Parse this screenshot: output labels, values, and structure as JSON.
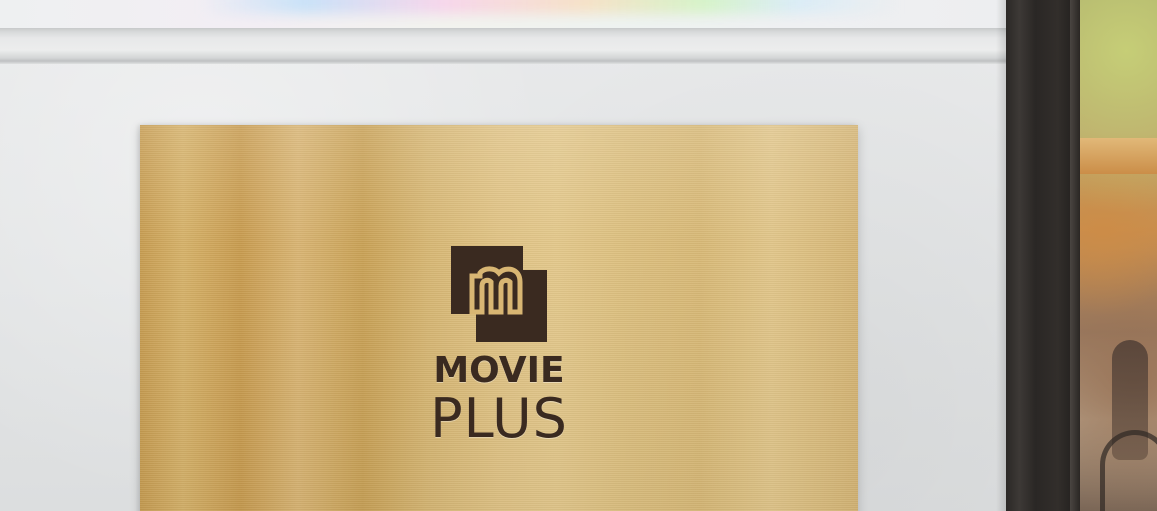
{
  "scene": {
    "description_free": true
  },
  "plaque": {
    "brand_line_1": "MOVIE",
    "brand_line_2": "PLUS",
    "logo_letter_icon": "m-monogram-icon"
  },
  "colors": {
    "gold": "#d6b775",
    "logo_brown": "#3a2a20",
    "wall": "#e4e6e7",
    "frame": "#2e2a27"
  }
}
